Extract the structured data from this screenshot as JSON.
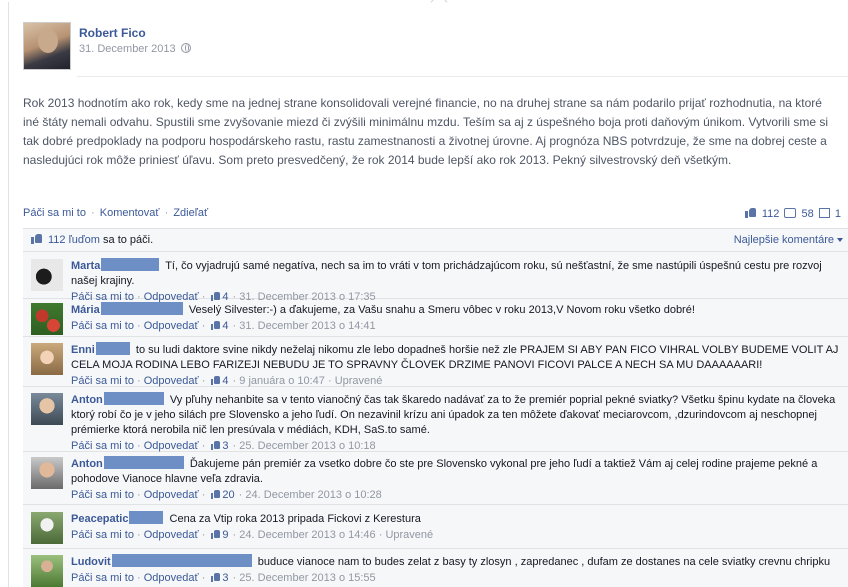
{
  "post": {
    "author": "Robert Fico",
    "date": "31. December 2013",
    "text": "Rok 2013 hodnotím ako rok, kedy sme na jednej strane konsolidovali verejné financie, no na druhej strane sa nám podarilo prijať rozhodnutia, na ktoré iné štáty nemali odvahu. Spustili sme zvyšovanie miezd či zvýšili minimálnu mzdu. Teším sa aj z úspešného boja proti daňovým únikom. Vytvorili sme si tak dobré predpoklady na podporu hospodárskeho rastu, rastu zamestnanosti a životnej úrovne. Aj prognóza NBS potvrdzuje, že sme na dobrej ceste a nasledujúci rok môže priniesť úľavu. Som preto presvedčený, že rok 2014 bude lepší ako rok 2013. Pekný silvestrovský deň všetkým.",
    "actions": {
      "like": "Páči sa mi to",
      "comment": "Komentovať",
      "share": "Zdieľať"
    },
    "counts": {
      "likes": "112",
      "comments": "58",
      "shares": "1"
    }
  },
  "likes_row": {
    "people": "112 ľuďom",
    "suffix": " sa to páči.",
    "sort": "Najlepšie komentáre"
  },
  "comment_actions": {
    "like": "Páči sa mi to",
    "reply": "Odpovedať",
    "edited": "Upravené"
  },
  "comments": [
    {
      "name": "Marta",
      "text": "Tí, čo vyjadrujú samé negatíva, nech sa im to vráti v tom prichádzajúcom roku, sú nešťastní, že sme nastúpili úspešnú cestu pre rozvoj našej krajiny.",
      "likes": "4",
      "date": "31. December 2013 o 17:35",
      "edited": false
    },
    {
      "name": "Mária",
      "text": "Veselý Silvester:-) a ďakujeme, za Vašu snahu a Smeru vôbec v roku 2013,V Novom roku všetko dobré!",
      "likes": "4",
      "date": "31. December 2013 o 14:41",
      "edited": false
    },
    {
      "name": "Enni",
      "text": "to su ludi daktore svine nikdy neželaj nikomu zle lebo dopadneš horšie než zle PRAJEM SI ABY PAN FICO VIHRAL VOLBY BUDEME VOLIT AJ CELA MOJA RODINA LEBO FARIZEJI NEBUDU JE TO SPRAVNY ČLOVEK DRZIME PANOVI FICOVI PALCE A NECH SA MU DAAAAAARI!",
      "likes": "4",
      "date": "9 januára o 10:47",
      "edited": true
    },
    {
      "name": "Anton",
      "text": "Vy pľuhy nehanbite sa v tento vianočný čas tak škaredo nadávať za to že premiér poprial pekné sviatky? Všetku špinu kydate na človeka ktorý robí čo je v jeho silách pre Slovensko a jeho ľudí. On nezavinil krízu ani úpadok za ten môžete ďakovať meciarovcom, ,dzurindovcom aj neschopnej prémierke ktorá nerobila nič len presúvala v médiách, KDH, SaS.to samé.",
      "likes": "3",
      "date": "25. December 2013 o 10:18",
      "edited": false
    },
    {
      "name": "Anton",
      "text": "Ďakujeme pán premiér za vsetko dobre čo ste pre Slovensko vykonal pre jeho ľudí a taktiež Vám aj celej rodine prajeme pekné a pohodove Vianoce hlavne veľa zdravia.",
      "likes": "20",
      "date": "24. December 2013 o 10:28",
      "edited": false
    },
    {
      "name": "Peacepatic",
      "text": "Cena za Vtip roka 2013 pripada Fickovi z Kerestura",
      "likes": "9",
      "date": "24. December 2013 o 14:46",
      "edited": true
    },
    {
      "name": "Ludovit",
      "text": "buduce vianoce nam to budes zelat z basy ty zlosyn , zapredanec , dufam ze dostanes na cele sviatky crevnu chripku",
      "likes": "3",
      "date": "25. December 2013 o 15:55",
      "edited": false
    }
  ]
}
